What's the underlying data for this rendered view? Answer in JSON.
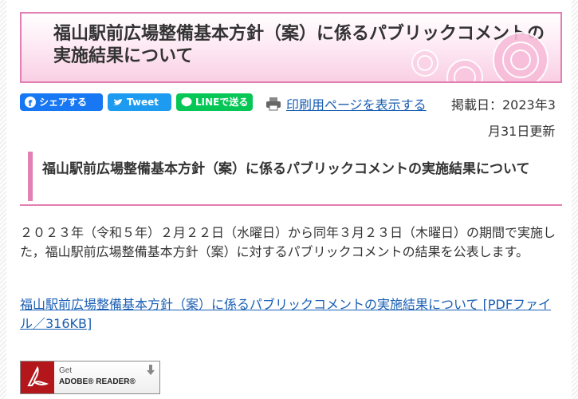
{
  "page": {
    "title": "福山駅前広場整備基本方針（案）に係るパブリックコメントの実施結果について"
  },
  "share": {
    "facebook_label": "シェアする",
    "twitter_label": "Tweet",
    "line_label": "LINEで送る",
    "facebook_color": "#1877f2",
    "twitter_color": "#1d9bf0",
    "line_color": "#06c755"
  },
  "print": {
    "label": "印刷用ページを表示する"
  },
  "meta": {
    "posted": "掲載日：2023年3",
    "updated": "月31日更新"
  },
  "section": {
    "heading": "福山駅前広場整備基本方針（案）に係るパブリックコメントの実施結果について"
  },
  "body": {
    "paragraph": "２０２３年（令和５年）２月２２日（水曜日）から同年３月２３日（木曜日）の期間で実施した，福山駅前広場整備基本方針（案）に対するパブリックコメントの結果を公表します。"
  },
  "attachment": {
    "link_text": "福山駅前広場整備基本方針（案）に係るパブリックコメントの実施結果について [PDFファイル／316KB]"
  },
  "adobe": {
    "get": "Get",
    "name": "ADOBE® READER®"
  },
  "colors": {
    "accent_pink": "#e27fb3",
    "link_blue": "#1a5fb4"
  }
}
